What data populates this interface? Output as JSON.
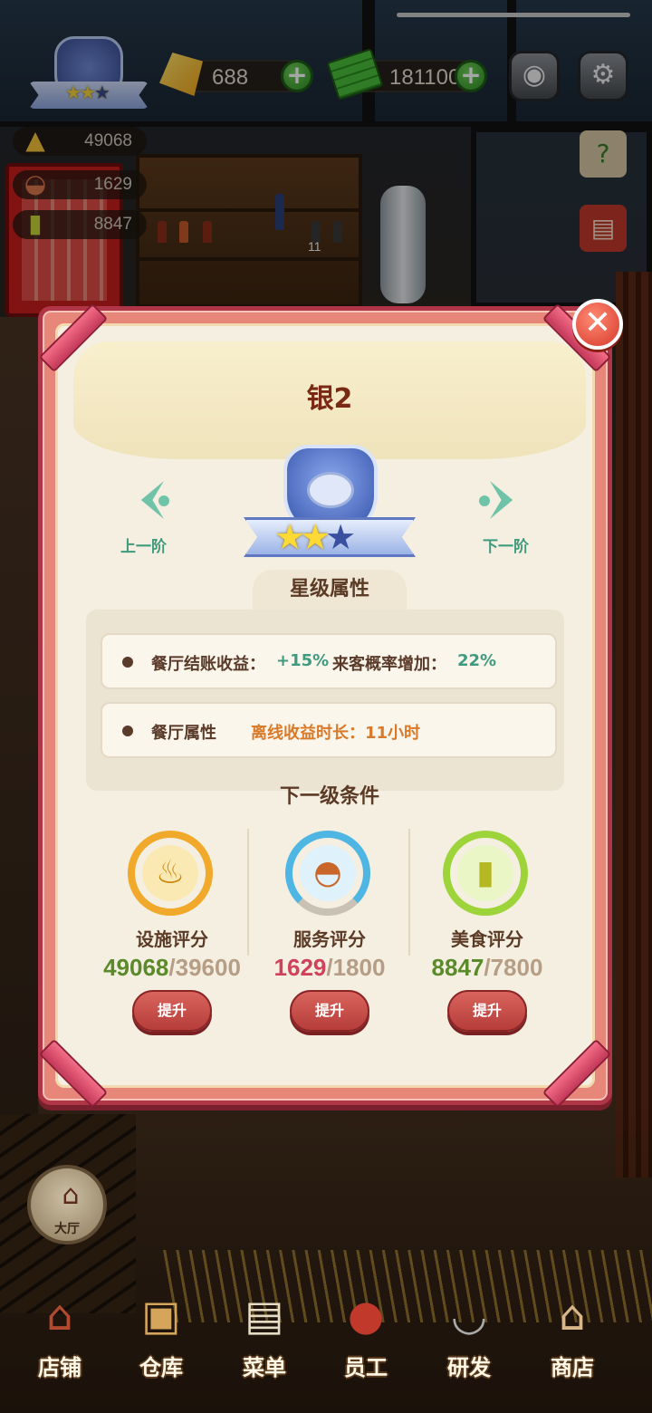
{
  "hud": {
    "gems": "688",
    "cash": "181100",
    "scores": {
      "facility": "49068",
      "service": "1629",
      "food": "8847"
    },
    "shelf_count": "11"
  },
  "modal": {
    "title": "银2",
    "prev_label": "上一阶",
    "next_label": "下一阶",
    "stars_filled": 2,
    "stars_total": 3,
    "attributes_title": "星级属性",
    "attr_rows": [
      {
        "label": "餐厅结账收益：",
        "value1": "+15%",
        "label2": "来客概率增加：",
        "value2": "22%"
      },
      {
        "label": "餐厅属性",
        "value": "离线收益时长：11小时"
      }
    ],
    "next_level_title": "下一级条件",
    "conditions": [
      {
        "name": "设施评分",
        "current": "49068",
        "required": "/39600",
        "button": "提升",
        "ring_color": "#f0a92a",
        "score_color": "#5a8a2a",
        "icon": "cooking-pot-icon"
      },
      {
        "name": "服务评分",
        "current": "1629",
        "required": "/1800",
        "button": "提升",
        "ring_color": "#4fb5e3",
        "score_color": "#d0425b",
        "icon": "service-tray-icon"
      },
      {
        "name": "美食评分",
        "current": "8847",
        "required": "/7800",
        "button": "提升",
        "ring_color": "#9dd43a",
        "score_color": "#5a8a2a",
        "icon": "menu-book-icon"
      }
    ]
  },
  "nav": {
    "hall": "大厅",
    "items": [
      "店铺",
      "仓库",
      "菜单",
      "员工",
      "研发",
      "商店"
    ]
  }
}
